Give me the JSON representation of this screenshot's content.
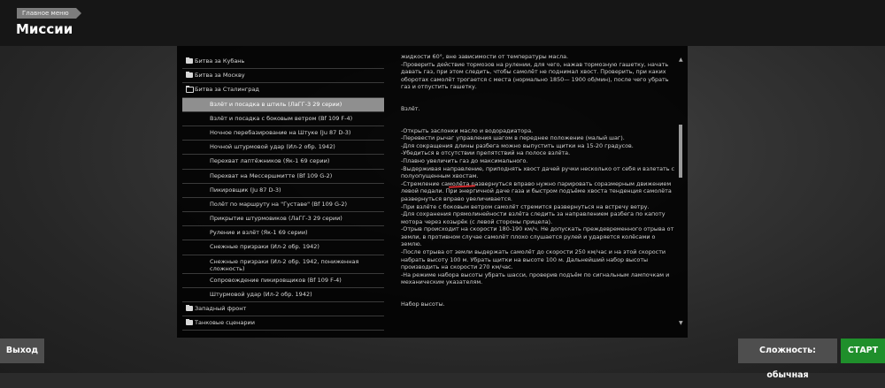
{
  "header": {
    "breadcrumb": "Главное меню",
    "title": "Миссии"
  },
  "tree": {
    "categories_top": [
      {
        "label": "Битва за Кубань",
        "state": "closed"
      },
      {
        "label": "Битва за Москву",
        "state": "closed"
      },
      {
        "label": "Битва за Сталинград",
        "state": "open"
      }
    ],
    "missions": [
      {
        "label": "Взлёт и посадка в штиль (ЛаГГ-3 29 серии)",
        "selected": true
      },
      {
        "label": "Взлёт и посадка с боковым ветром (Bf 109 F-4)"
      },
      {
        "label": "Ночное перебазирование на Штуке (Ju 87 D-3)"
      },
      {
        "label": "Ночной штурмовой удар (Ил-2 обр. 1942)"
      },
      {
        "label": "Перехват лаптёжников (Як-1 69 серии)"
      },
      {
        "label": "Перехват на Мессершмитте (Bf 109 G-2)"
      },
      {
        "label": "Пикировщик (Ju 87 D-3)"
      },
      {
        "label": "Полёт по маршруту на \"Густаве\" (Bf 109 G-2)"
      },
      {
        "label": "Прикрытие штурмовиков (ЛаГГ-3 29 серии)"
      },
      {
        "label": "Руление и взлёт (Як-1 69 серии)"
      },
      {
        "label": "Снежные призраки (Ил-2 обр. 1942)"
      },
      {
        "label": "Снежные призраки (Ил-2 обр. 1942, пониженная сложность)"
      },
      {
        "label": "Сопровождение пикировщиков (Bf 109 F-4)"
      },
      {
        "label": "Штурмовой удар (Ил-2 обр. 1942)"
      }
    ],
    "categories_bottom": [
      {
        "label": "Западный фронт",
        "state": "closed"
      },
      {
        "label": "Танковые сценарии",
        "state": "closed"
      }
    ]
  },
  "description": {
    "para1": [
      "жидкости 60°, вне зависимости от температуры масла.",
      "-Проверить действие тормозов на рулении, для чего, нажав тормозную гашетку, начать давать газ, при этом следить, чтобы самолёт не поднимал хвост. Проверить, при каких оборотах самолёт трогается с места (нормально 1850— 1900 об/мин), после чего убрать газ и отпустить гашетку."
    ],
    "heading_takeoff": "Взлёт.",
    "para2": [
      "-Открыть заслонки масло и водорадиатора.",
      "-Перевести рычаг управления шагом в переднее положение (малый шаг).",
      "-Для сокращения длины разбега можно выпустить щитки на 15-20 градусов.",
      "-Убедиться в отсутствии препятствий на полосе взлёта.",
      "-Плавно увеличить газ до максимального.",
      "-Выдерживая направление, приподнять хвост дачей ручки несколько от себя и взлетать с полуопущенным хвостам.",
      "-Стремление самолёта развернуться вправо нужно парировать соразмерным движением левой педали. При энергичной даче газа и быстром подъёме хвоста тенденция самолёта развернуться вправо увеличивается.",
      "-При взлёте с боковым ветром самолёт стремится развернуться на встречу ветру.",
      "-Для сохранения прямолинейности взлёта следить за направлением разбега по капоту мотора через козырёк (с левой стороны прицела).",
      "-Отрыв происходит на скорости 180-190 км/ч. Не допускать преждевременного отрыва от земли, в противном случае самолёт плохо слушается рулей и ударяется колёсами о землю.",
      "-После отрыва от земли выдержать самолёт до скорости 250 км/час и на этой скорости набрать высоту 100 м. Убрать щитки на высоте 100 м. Дальнейший набор высоты производить на скорости 270 км/час.",
      "-На режиме набора высоты убрать шасси, проверив подъём по сигнальным лампочкам и механическим указателям."
    ],
    "heading_climb": "Набор высоты."
  },
  "buttons": {
    "exit": "Выход",
    "difficulty": "Сложность: обычная",
    "start": "СТАРТ"
  },
  "colors": {
    "start_button": "#1f8f2b",
    "selected_row": "#8f8f8f"
  }
}
